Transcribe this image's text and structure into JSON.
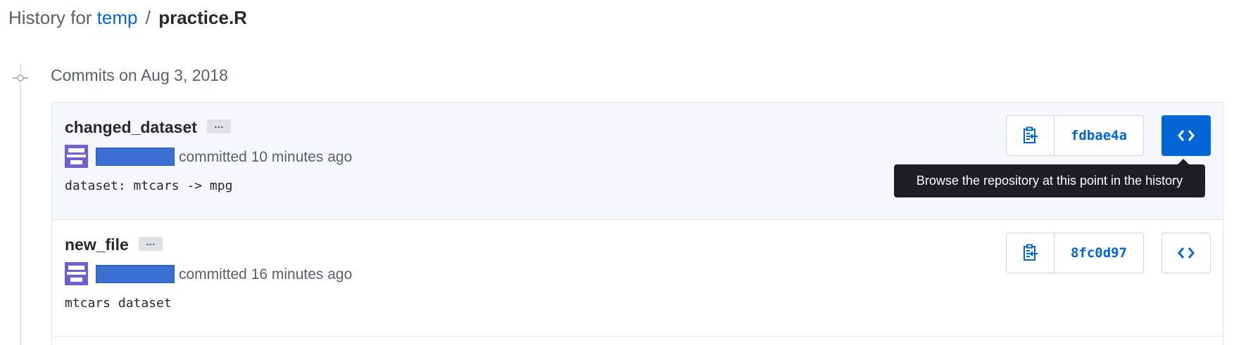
{
  "breadcrumb": {
    "prefix": "History for",
    "repo": "temp",
    "separator": "/",
    "file": "practice.R"
  },
  "group": {
    "title": "Commits on Aug 3, 2018"
  },
  "commits": [
    {
      "title": "changed_dataset",
      "ellipsis": "…",
      "committed": "committed 10 minutes ago",
      "description": "dataset: mtcars -> mpg",
      "sha": "fdbae4a",
      "copy_icon": "clippy-icon",
      "browse_icon": "code-icon"
    },
    {
      "title": "new_file",
      "ellipsis": "…",
      "committed": "committed 16 minutes ago",
      "description": "mtcars dataset",
      "sha": "8fc0d97",
      "copy_icon": "clippy-icon",
      "browse_icon": "code-icon"
    }
  ],
  "tooltip": {
    "text": "Browse the repository at this point in the history"
  },
  "colors": {
    "link": "#0366d6",
    "active_button": "#0366d6",
    "tooltip_bg": "#1b1f23",
    "redaction": "#3b6fd1",
    "avatar": "#6f5fd0"
  }
}
